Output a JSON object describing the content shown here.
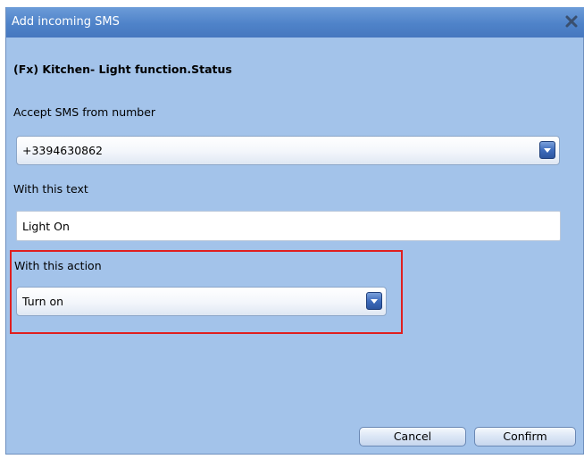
{
  "dialog": {
    "title": "Add incoming SMS",
    "close_icon": "close-x-icon",
    "heading": "(Fx) Kitchen- Light function.Status"
  },
  "form": {
    "number_label": "Accept SMS from number",
    "number_value": "+3394630862",
    "text_label": "With this text",
    "text_value": "Light On",
    "action_label": "With this action",
    "action_value": "Turn on",
    "dropdown_icon": "chevron-down-icon"
  },
  "buttons": {
    "cancel_label": "Cancel",
    "confirm_label": "Confirm"
  },
  "colors": {
    "dialog_background": "#a3c3ea",
    "titlebar": "#4f83c9",
    "highlight_border": "#e01f1f"
  }
}
